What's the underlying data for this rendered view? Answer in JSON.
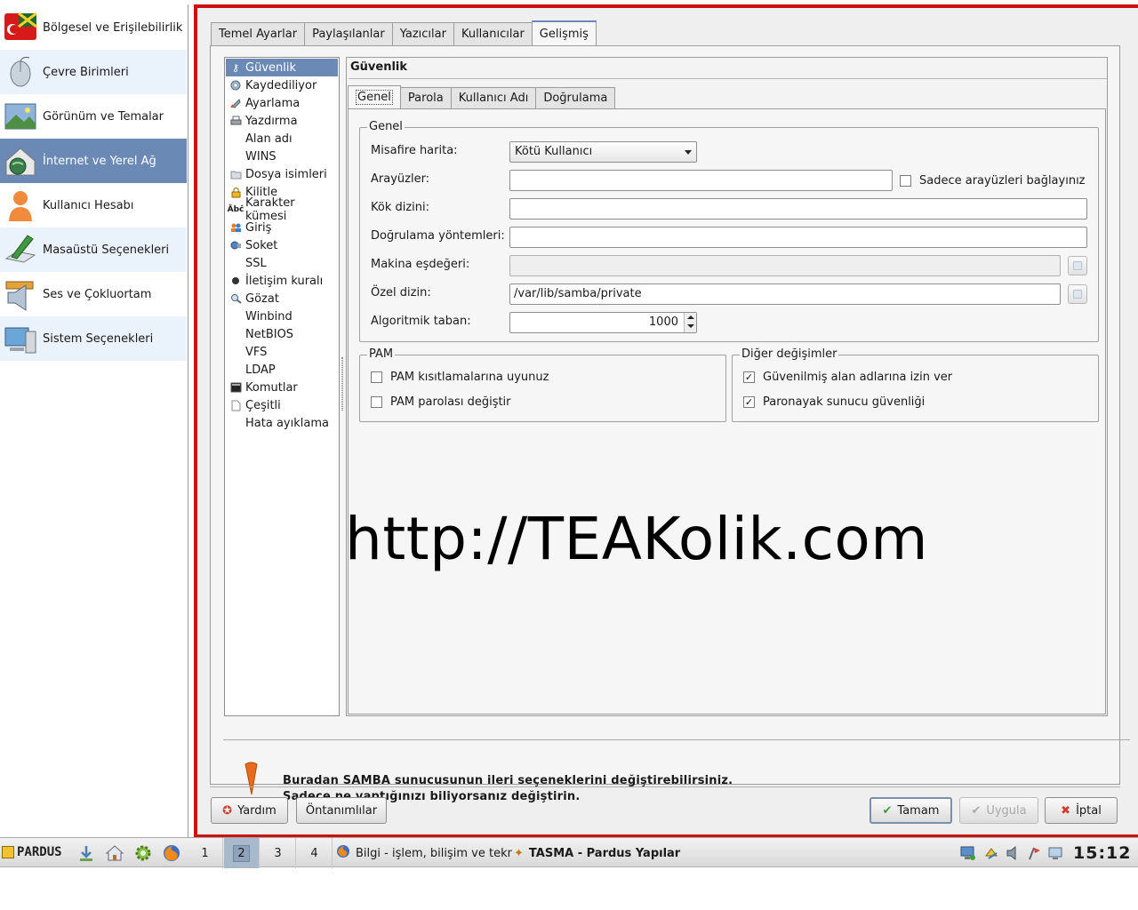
{
  "sidebar": {
    "items": [
      {
        "label": "Bölgesel ve Erişilebilirlik",
        "icon": "flag-icon"
      },
      {
        "label": "Çevre Birimleri",
        "icon": "mouse-icon"
      },
      {
        "label": "Görünüm ve Temalar",
        "icon": "picture-icon"
      },
      {
        "label": "İnternet ve Yerel Ağ",
        "icon": "network-house-icon"
      },
      {
        "label": "Kullanıcı Hesabı",
        "icon": "user-icon"
      },
      {
        "label": "Masaüstü Seçenekleri",
        "icon": "desktop-pen-icon"
      },
      {
        "label": "Ses ve Çokluortam",
        "icon": "speaker-icon"
      },
      {
        "label": "Sistem Seçenekleri",
        "icon": "computer-icon"
      }
    ],
    "active_index": 3
  },
  "main": {
    "tabs": [
      "Temel Ayarlar",
      "Paylaşılanlar",
      "Yazıcılar",
      "Kullanıcılar",
      "Gelişmiş"
    ],
    "active_tab": "Gelişmiş",
    "tree": [
      {
        "label": "Güvenlik",
        "icon": "key-icon"
      },
      {
        "label": "Kaydediliyor",
        "icon": "disc-icon"
      },
      {
        "label": "Ayarlama",
        "icon": "rocket-icon"
      },
      {
        "label": "Yazdırma",
        "icon": "printer-icon"
      },
      {
        "label": "Alan adı",
        "icon": ""
      },
      {
        "label": "WINS",
        "icon": ""
      },
      {
        "label": "Dosya isimleri",
        "icon": "folder-icon"
      },
      {
        "label": "Kilitle",
        "icon": "lock-icon"
      },
      {
        "label": "Karakter kümesi",
        "icon": "charset-icon"
      },
      {
        "label": "Giriş",
        "icon": "users-icon"
      },
      {
        "label": "Soket",
        "icon": "socket-icon"
      },
      {
        "label": "SSL",
        "icon": ""
      },
      {
        "label": "İletişim kuralı",
        "icon": "bullet-icon"
      },
      {
        "label": "Gözat",
        "icon": "browse-icon"
      },
      {
        "label": "Winbind",
        "icon": ""
      },
      {
        "label": "NetBIOS",
        "icon": ""
      },
      {
        "label": "VFS",
        "icon": ""
      },
      {
        "label": "LDAP",
        "icon": ""
      },
      {
        "label": "Komutlar",
        "icon": "terminal-icon"
      },
      {
        "label": "Çeşitli",
        "icon": "document-icon"
      },
      {
        "label": "Hata ayıklama",
        "icon": ""
      }
    ],
    "selected_tree_item": "Güvenlik",
    "panel_title": "Güvenlik",
    "subtabs": [
      "Genel",
      "Parola",
      "Kullanıcı Adı",
      "Doğrulama"
    ],
    "active_subtab": "Genel",
    "general": {
      "group_title": "Genel",
      "guest_map": {
        "label": "Misafire harita:",
        "value": "Kötü Kullanıcı"
      },
      "interfaces": {
        "label": "Arayüzler:",
        "value": ""
      },
      "bind_interfaces_only": {
        "label": "Sadece arayüzleri bağlayınız",
        "checked": false
      },
      "root_dir": {
        "label": "Kök dizini:",
        "value": ""
      },
      "auth_methods": {
        "label": "Doğrulama yöntemleri:",
        "value": ""
      },
      "machine_password": {
        "label": "Makina eşdeğeri:",
        "value": ""
      },
      "private_dir": {
        "label": "Özel dizin:",
        "value": "/var/lib/samba/private"
      },
      "algorithmic_base": {
        "label": "Algoritmik taban:",
        "value": "1000"
      }
    },
    "pam": {
      "group_title": "PAM",
      "obey_pam": {
        "label": "PAM kısıtlamalarına uyunuz",
        "checked": false
      },
      "pam_password_change": {
        "label": "PAM parolası değiştir",
        "checked": false
      }
    },
    "other": {
      "group_title": "Diğer değişimler",
      "allow_trusted_domains": {
        "label": "Güvenilmiş alan adlarına izin ver",
        "checked": true
      },
      "paranoid_server_security": {
        "label": "Paronayak sunucu güvenliği",
        "checked": true
      }
    },
    "watermark": "http://TEAKolik.com",
    "hint": {
      "line1": "Buradan SAMBA sunucusunun ileri seçeneklerini değiştirebilirsiniz.",
      "line2": "Sadece ne yaptığınızı biliyorsanız değiştirin."
    },
    "buttons": {
      "help": "Yardım",
      "defaults": "Öntanımlılar",
      "ok": "Tamam",
      "apply": "Uygula",
      "cancel": "İptal"
    }
  },
  "taskbar": {
    "logo": "PARDUS",
    "desktops": [
      "1",
      "2",
      "3",
      "4"
    ],
    "active_desktop": "2",
    "tasks": [
      {
        "label": "Bilgi - işlem, bilişim ve tekn",
        "icon": "firefox-icon"
      },
      {
        "label": "TASMA - Pardus Yapılar",
        "icon": "tasma-icon"
      }
    ],
    "clock": "15:12"
  },
  "colors": {
    "window_border": "#cc1111",
    "selection": "#6a89b5",
    "hint_icon": "#e86b1a"
  }
}
